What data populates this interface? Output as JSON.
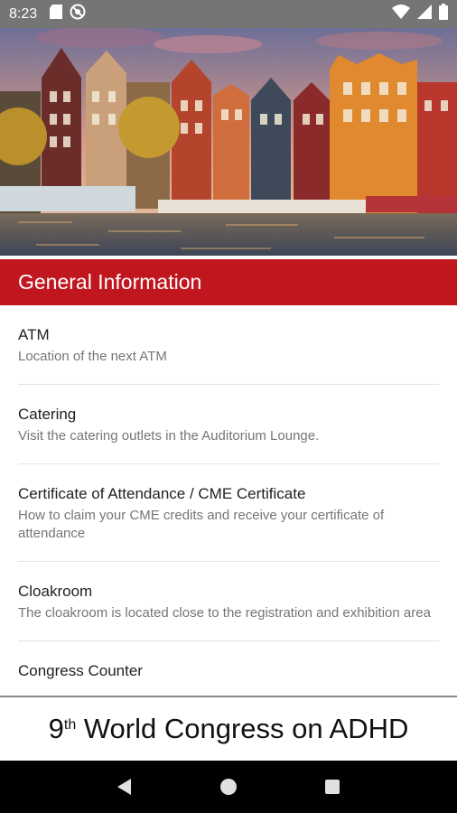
{
  "status_bar": {
    "time": "8:23",
    "icons_left": [
      "sd-card-icon",
      "do-not-disturb-icon"
    ],
    "icons_right": [
      "wifi-icon",
      "signal-icon",
      "battery-icon"
    ]
  },
  "hero": {
    "image": "amsterdam-canal-houses-photo"
  },
  "section": {
    "title": "General Information"
  },
  "items": [
    {
      "title": "ATM",
      "subtitle": "Location of the next ATM"
    },
    {
      "title": "Catering",
      "subtitle": "Visit the catering outlets in the Auditorium Lounge."
    },
    {
      "title": "Certificate of Attendance / CME Certificate",
      "subtitle": "How to claim your CME credits and receive your certificate of attendance"
    },
    {
      "title": "Cloakroom",
      "subtitle": "The cloakroom is located close to the registration and exhibition area"
    },
    {
      "title": "Congress Counter",
      "subtitle": ""
    }
  ],
  "footer": {
    "ordinal": "9",
    "ordinal_suffix": "th",
    "title": "World Congress on ADHD"
  },
  "colors": {
    "header_red": "#c0171f",
    "status_bar": "#757575"
  }
}
